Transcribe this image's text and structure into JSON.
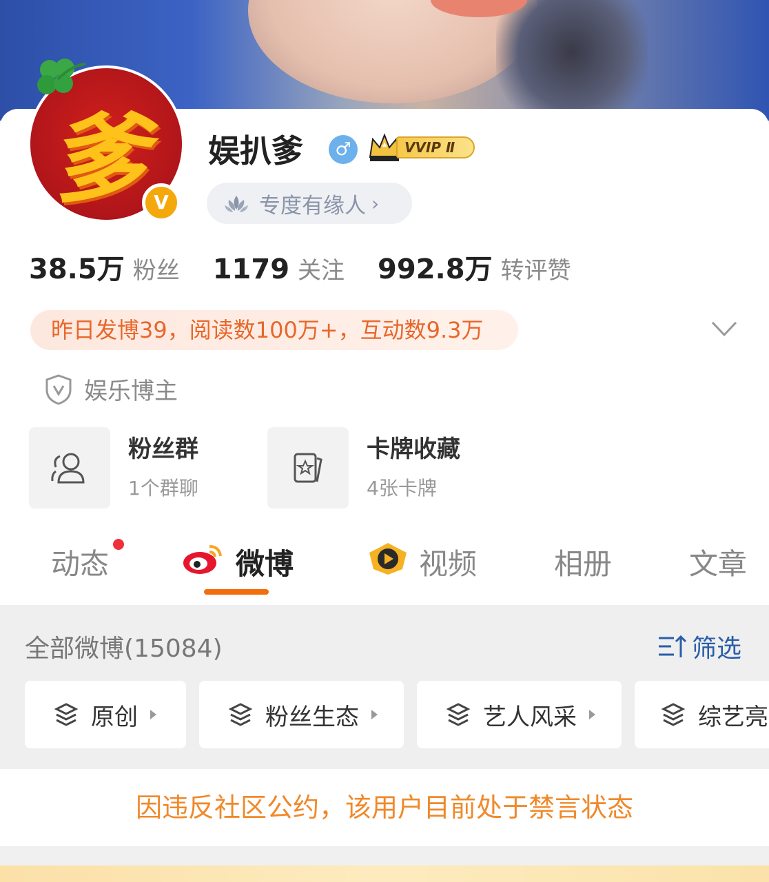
{
  "profile": {
    "name": "娱扒爹",
    "gender_symbol": "♂",
    "vip_badge": "VVIP Ⅱ",
    "avatar_glyph": "爹",
    "verified_mark": "V",
    "destiny_label": "专度有缘人",
    "destiny_arrow": "›"
  },
  "stats": {
    "fans_value": "38.5万",
    "fans_label": "粉丝",
    "following_value": "1179",
    "following_label": "关注",
    "interactions_value": "992.8万",
    "interactions_label": "转评赞"
  },
  "activity": {
    "text": "昨日发博39，阅读数100万+，互动数9.3万"
  },
  "role": {
    "text": "娱乐博主"
  },
  "tiles": {
    "fan_group": {
      "title": "粉丝群",
      "subtitle": "1个群聊"
    },
    "cards": {
      "title": "卡牌收藏",
      "subtitle": "4张卡牌"
    }
  },
  "tabs": {
    "dynamics": "动态",
    "weibo": "微博",
    "video": "视频",
    "album": "相册",
    "article": "文章"
  },
  "filter": {
    "all_count": "全部微博(15084)",
    "filter_label": "筛选"
  },
  "chips": [
    "原创",
    "粉丝生态",
    "艺人风采",
    "综艺亮"
  ],
  "notice": {
    "text": "因违反社区公约，该用户目前处于禁言状态"
  },
  "colors": {
    "accent_orange": "#f26d0c",
    "notice_orange": "#f0892a",
    "link_blue": "#2a5ea8",
    "badge_red": "#f0303a"
  }
}
